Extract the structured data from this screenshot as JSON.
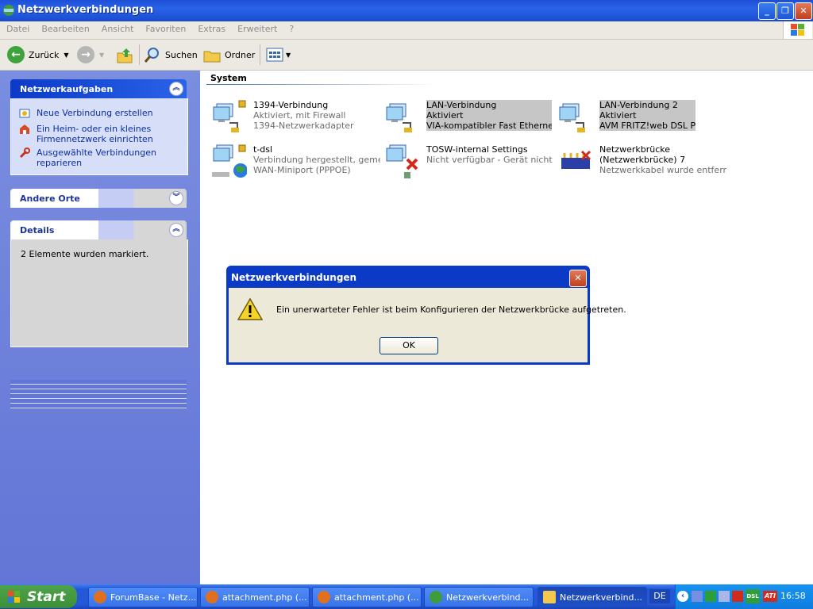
{
  "window": {
    "title": "Netzwerkverbindungen"
  },
  "menu": [
    "Datei",
    "Bearbeiten",
    "Ansicht",
    "Favoriten",
    "Extras",
    "Erweitert",
    "?"
  ],
  "toolbar": {
    "back": "Zurück",
    "search": "Suchen",
    "folders": "Ordner"
  },
  "left": {
    "tasks": {
      "title": "Netzwerkaufgaben",
      "items": [
        {
          "label": "Neue Verbindung erstellen"
        },
        {
          "label": "Ein Heim- oder ein kleines Firmennetzwerk einrichten"
        },
        {
          "label": "Ausgewählte Verbindungen reparieren"
        }
      ]
    },
    "other": {
      "title": "Andere Orte"
    },
    "details": {
      "title": "Details",
      "text": "2 Elemente wurden markiert."
    }
  },
  "content": {
    "group_title": "System",
    "connections": [
      {
        "name": "1394-Verbindung",
        "status": "Aktiviert, mit Firewall",
        "device": "1394-Netzwerkadapter",
        "selected": false
      },
      {
        "name": "LAN-Verbindung",
        "status": "Aktiviert",
        "device": "VIA-kompatibler Fast Ethernet...",
        "selected": true
      },
      {
        "name": "LAN-Verbindung 2",
        "status": "Aktiviert",
        "device": "AVM FRITZ!web DSL PPP",
        "selected": true
      },
      {
        "name": "t-dsl",
        "status": "Verbindung hergestellt, gemei...",
        "device": "WAN-Miniport (PPPOE)",
        "selected": false
      },
      {
        "name": "TOSW-internal Settings",
        "status": "Nicht verfügbar - Gerät nicht ...",
        "device": "",
        "selected": false
      },
      {
        "name": "Netzwerkbrücke",
        "status": "(Netzwerkbrücke) 7",
        "device": "Netzwerkkabel wurde entfernt",
        "selected": false
      }
    ]
  },
  "dialog": {
    "title": "Netzwerkverbindungen",
    "message": "Ein unerwarteter Fehler ist beim Konfigurieren der Netzwerkbrücke aufgetreten.",
    "ok": "OK"
  },
  "taskbar": {
    "start": "Start",
    "tasks": [
      {
        "label": "ForumBase - Netz..."
      },
      {
        "label": "attachment.php (..."
      },
      {
        "label": "attachment.php (..."
      },
      {
        "label": "Netzwerkverbind..."
      },
      {
        "label": "Netzwerkverbind..."
      }
    ],
    "lang": "DE",
    "clock": "16:58",
    "tray_labels": {
      "ati": "ATI",
      "dsl": "DSL"
    }
  }
}
